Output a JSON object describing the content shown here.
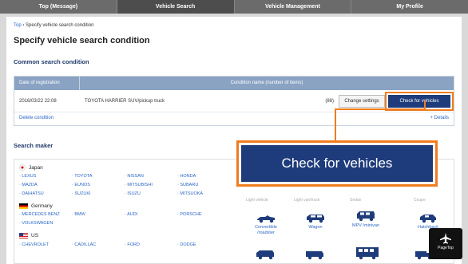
{
  "nav": {
    "tabs": [
      "Top (Message)",
      "Vehicle Search",
      "Vehicle Management",
      "My Profile"
    ],
    "active_index": 1
  },
  "breadcrumb": {
    "home": "Top",
    "separator": "›",
    "current": "Specify vehicle search condition"
  },
  "page_title": "Specify vehicle search condition",
  "common": {
    "heading": "Common search condition",
    "col_date": "Date of registration",
    "col_name": "Condition name (number of items)",
    "row": {
      "date": "2016/03/22 22:08",
      "name": "TOYOTA HARRIER SUV/pickup truck",
      "count": "(88)",
      "change_label": "Change settings",
      "check_label": "Check for vehicles"
    },
    "delete_label": "Delete condition",
    "details_label": "+ Details"
  },
  "maker": {
    "heading": "Search maker",
    "countries": [
      {
        "name": "Japan",
        "makers": [
          "LEXUS",
          "TOYOTA",
          "NISSAN",
          "HONDA",
          "MAZDA",
          "EUNOS",
          "MITSUBISHI",
          "SUBARU",
          "DAIHATSU",
          "SUZUKI",
          "ISUZU",
          "MITSUOKA"
        ]
      },
      {
        "name": "Germany",
        "makers": [
          "MERCEDES BENZ",
          "BMW",
          "AUDI",
          "PORSCHE",
          "VOLKSWAGEN"
        ]
      },
      {
        "name": "US",
        "makers": [
          "CHEVROLET",
          "CADILLAC",
          "FORD",
          "DODGE"
        ]
      }
    ]
  },
  "body_types": {
    "partial_top": [
      "Light vehicle",
      "Light van/truck",
      "Sedan",
      "Coupe"
    ],
    "items": [
      "Convertible /roadster",
      "Wagon",
      "MPV /minivan",
      "Hatchback"
    ]
  },
  "callout_label": "Check for vehicles",
  "pagetop_label": "PageTop",
  "colors": {
    "accent": "#f07c1f",
    "button_navy": "#1e3c7b",
    "link": "#2b66c4",
    "table_header": "#8aa3c3"
  }
}
